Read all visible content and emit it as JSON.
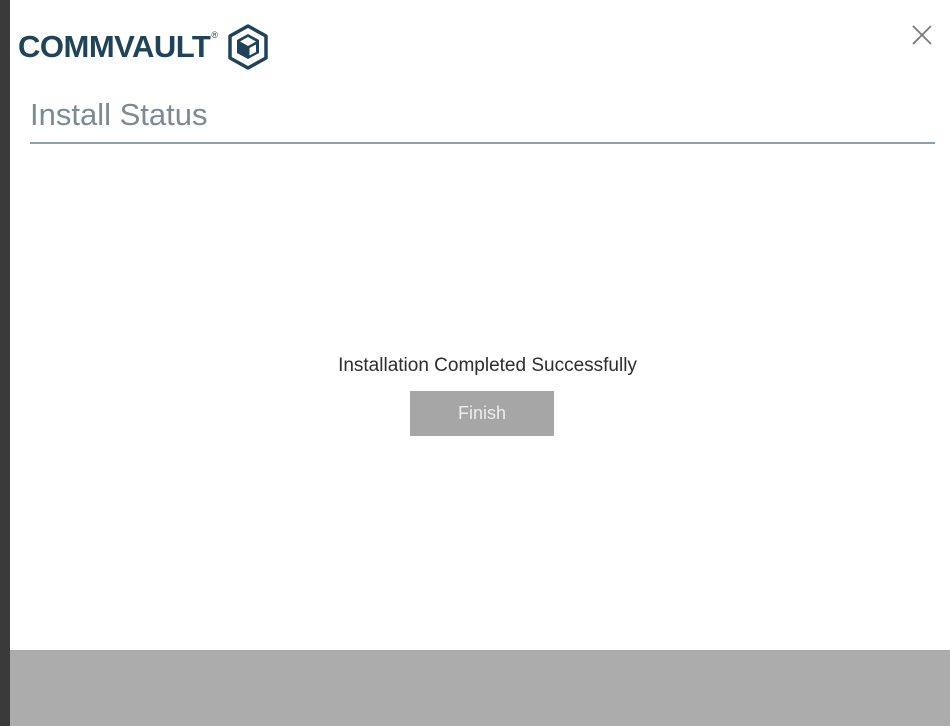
{
  "brand": {
    "name": "COMMVAULT",
    "trademark": "®",
    "color": "#1f4358",
    "icon": "commvault-cube-icon"
  },
  "window": {
    "close_icon": "close-icon"
  },
  "page": {
    "title": "Install Status"
  },
  "status": {
    "message": "Installation Completed Successfully"
  },
  "actions": {
    "finish_label": "Finish"
  },
  "colors": {
    "button_bg": "#a6a6a6",
    "footer_bg": "#acacac",
    "rule": "#8aa1b3"
  }
}
